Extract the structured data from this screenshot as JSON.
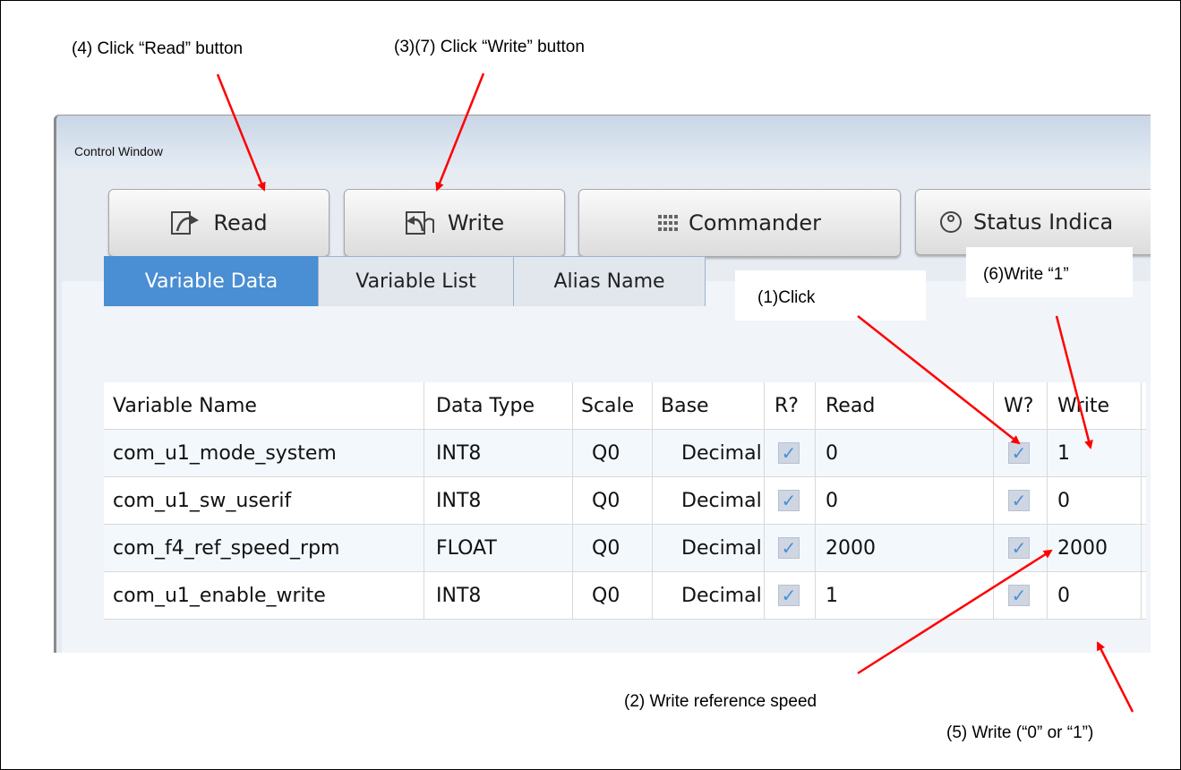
{
  "annotations": {
    "a4": "(4) Click “Read” button",
    "a37": "(3)(7) Click “Write” button",
    "a1": "(1)Click",
    "a6": "(6)Write “1”",
    "a2": "(2) Write reference speed",
    "a5": "(5) Write (“0” or “1”)"
  },
  "window": {
    "title": "Control Window"
  },
  "toolbar": {
    "read_label": "Read",
    "write_label": "Write",
    "commander_label": "Commander",
    "status_label": "Status Indica"
  },
  "tabs": [
    "Variable Data",
    "Variable List",
    "Alias Name"
  ],
  "table": {
    "headers": [
      "Variable Name",
      "Data Type",
      "Scale",
      "Base",
      "R?",
      "Read",
      "W?",
      "Write"
    ],
    "rows": [
      {
        "name": "com_u1_mode_system",
        "type": "INT8",
        "scale": "Q0",
        "base": "Decimal",
        "r": true,
        "read": "0",
        "w": true,
        "write": "1"
      },
      {
        "name": "com_u1_sw_userif",
        "type": "INT8",
        "scale": "Q0",
        "base": "Decimal",
        "r": true,
        "read": "0",
        "w": true,
        "write": "0"
      },
      {
        "name": "com_f4_ref_speed_rpm",
        "type": "FLOAT",
        "scale": "Q0",
        "base": "Decimal",
        "r": true,
        "read": "2000",
        "w": true,
        "write": "2000"
      },
      {
        "name": "com_u1_enable_write",
        "type": "INT8",
        "scale": "Q0",
        "base": "Decimal",
        "r": true,
        "read": "1",
        "w": true,
        "write": "0"
      }
    ]
  },
  "colors": {
    "tab_active": "#4a8ed3",
    "arrow": "#ff0000",
    "check": "#4a90d9"
  },
  "icons": {
    "read": "read-icon",
    "write": "write-icon",
    "commander": "grid-icon",
    "status": "gauge-icon",
    "check": "checkmark-icon"
  }
}
